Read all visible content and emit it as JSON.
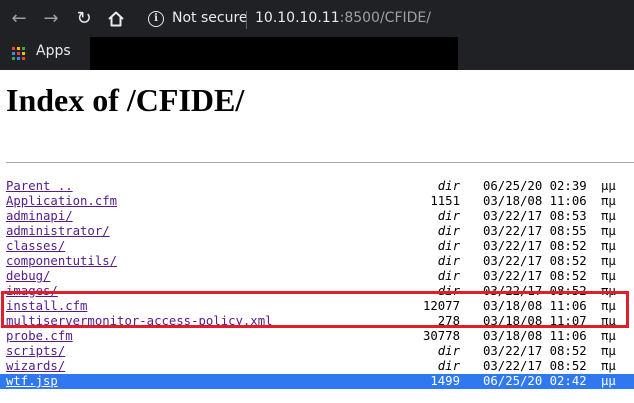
{
  "browser": {
    "security_label": "Not secure",
    "url_host": "10.10.10.11",
    "url_rest": ":8500/CFIDE/",
    "bookmarks": {
      "apps_label": "Apps"
    }
  },
  "page": {
    "title": "Index of /CFIDE/"
  },
  "listing": [
    {
      "name": "Parent ..",
      "size": "dir",
      "date": "06/25/20 02:39",
      "ampm": "μμ"
    },
    {
      "name": "Application.cfm",
      "size": "1151",
      "date": "03/18/08 11:06",
      "ampm": "πμ"
    },
    {
      "name": "adminapi/",
      "size": "dir",
      "date": "03/22/17 08:53",
      "ampm": "πμ"
    },
    {
      "name": "administrator/",
      "size": "dir",
      "date": "03/22/17 08:55",
      "ampm": "πμ"
    },
    {
      "name": "classes/",
      "size": "dir",
      "date": "03/22/17 08:52",
      "ampm": "πμ"
    },
    {
      "name": "componentutils/",
      "size": "dir",
      "date": "03/22/17 08:52",
      "ampm": "πμ"
    },
    {
      "name": "debug/",
      "size": "dir",
      "date": "03/22/17 08:52",
      "ampm": "πμ"
    },
    {
      "name": "images/",
      "size": "dir",
      "date": "03/22/17 08:52",
      "ampm": "πμ"
    },
    {
      "name": "install.cfm",
      "size": "12077",
      "date": "03/18/08 11:06",
      "ampm": "πμ"
    },
    {
      "name": "multiservermonitor-access-policy.xml",
      "size": "278",
      "date": "03/18/08 11:07",
      "ampm": "πμ"
    },
    {
      "name": "probe.cfm",
      "size": "30778",
      "date": "03/18/08 11:06",
      "ampm": "πμ"
    },
    {
      "name": "scripts/",
      "size": "dir",
      "date": "03/22/17 08:52",
      "ampm": "πμ"
    },
    {
      "name": "wizards/",
      "size": "dir",
      "date": "03/22/17 08:52",
      "ampm": "πμ"
    },
    {
      "name": "wtf.jsp",
      "size": "1499",
      "date": "06/25/20 02:42",
      "ampm": "μμ",
      "selected": true
    }
  ],
  "colors": {
    "link": "#551a8b",
    "selection": "#2f78f2",
    "highlight_box": "#e11d2a"
  }
}
